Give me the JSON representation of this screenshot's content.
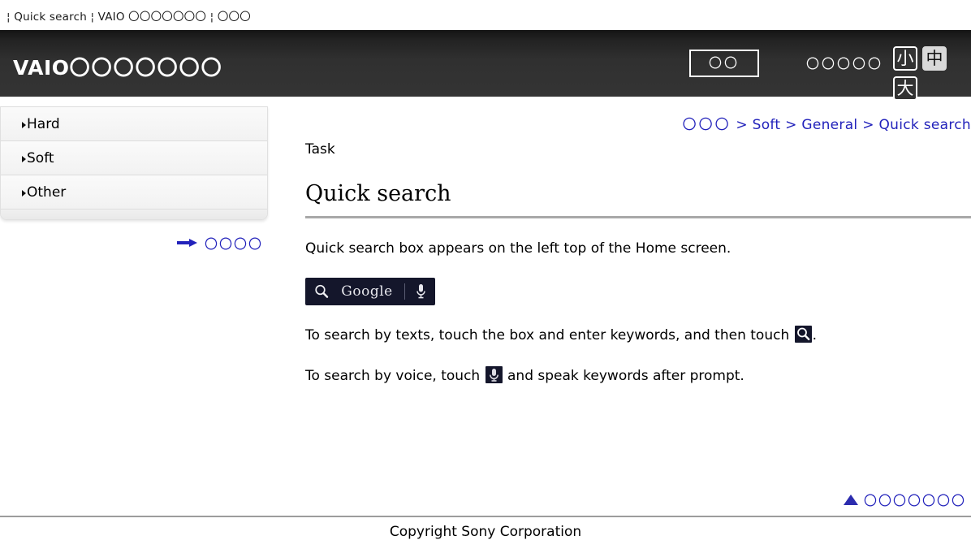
{
  "titlebar": {
    "text": "¦ Quick search ¦ VAIO 〇〇〇〇〇〇〇 ¦ 〇〇〇"
  },
  "header": {
    "brand": "VAIO",
    "brand_sub": "〇〇〇〇〇〇〇",
    "menu_button": "〇〇",
    "fontsize_label": "〇〇〇〇〇",
    "size_small": "小",
    "size_medium": "中",
    "size_large": "大",
    "selected_size": "中",
    "bg_color": "#303030",
    "selected_bg": "#d9d9d9"
  },
  "sidebar": {
    "items": [
      {
        "label": "Hard"
      },
      {
        "label": "Soft"
      },
      {
        "label": "Other"
      }
    ],
    "link": "〇〇〇〇"
  },
  "breadcrumb": {
    "home": "〇〇〇",
    "sep1": ">",
    "item1": "Soft",
    "sep2": ">",
    "item2": "General",
    "sep3": ">",
    "item3": "Quick search",
    "link_color": "#2222bb"
  },
  "main": {
    "kicker": "Task",
    "title": "Quick search",
    "paragraph1": "Quick search box appears on the left top of the Home screen.",
    "search_widget": {
      "logo": "Google",
      "search_icon": "magnifier-icon",
      "mic_icon": "microphone-icon",
      "bg_color": "#14162b"
    },
    "paragraph2_before": "To search by texts, touch the box and enter keywords, and then touch ",
    "paragraph2_after": ".",
    "paragraph3_before": "To search by voice, touch ",
    "paragraph3_after": " and speak keywords after prompt.",
    "back_to_top": "〇〇〇〇〇〇〇"
  },
  "footer": {
    "copyright": "Copyright Sony Corporation"
  }
}
